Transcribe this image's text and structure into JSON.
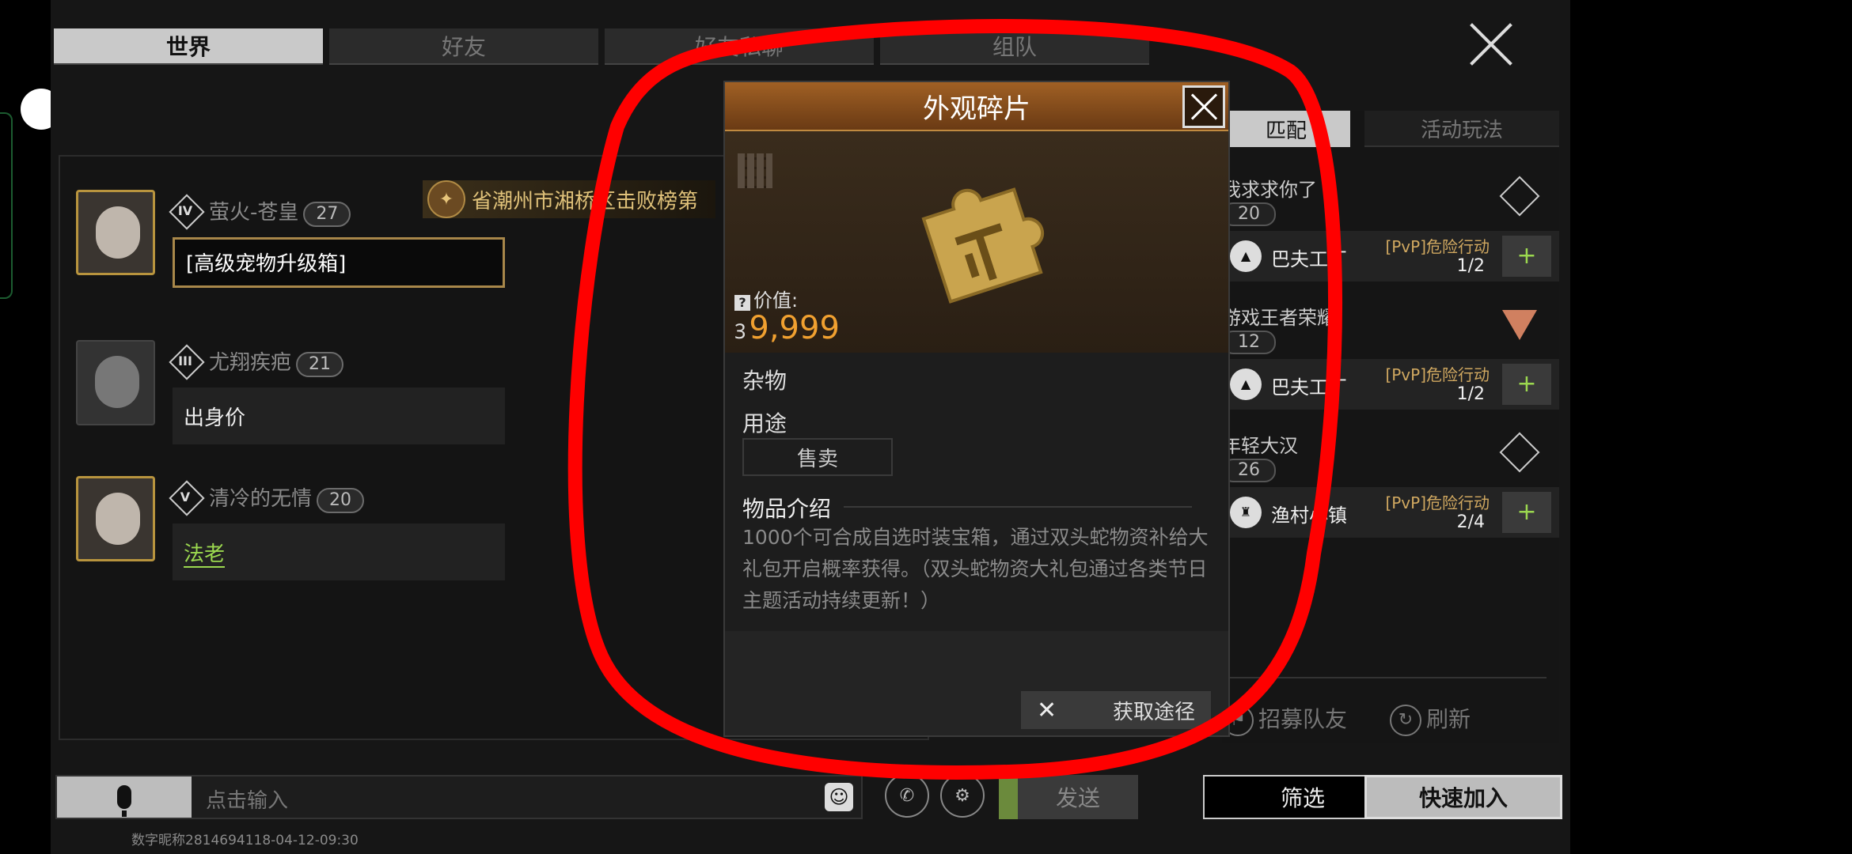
{
  "tabs": [
    "世界",
    "好友",
    "好友私聊",
    "组队"
  ],
  "chat": {
    "pinned": "省潮州市湘桥区击败榜第",
    "messages": [
      {
        "rank": "IV",
        "name": "萤火-苍皇",
        "level": "27",
        "text": "[高级宠物升级箱]"
      },
      {
        "rank": "III",
        "name": "尤翔疾疤",
        "level": "21",
        "text": "出身价"
      },
      {
        "rank": "V",
        "name": "清冷的无情",
        "level": "20",
        "text": "法老"
      }
    ]
  },
  "input": {
    "placeholder": "点击输入",
    "emoji": "☺"
  },
  "send_label": "发送",
  "footer_note": "数字昵称2814694118-04-12-09:30",
  "right_panel": {
    "tabs": [
      "匹配",
      "活动玩法"
    ],
    "teams": [
      {
        "name": "我求求你了",
        "level": "20",
        "map": "巴夫工厂",
        "mode": "[PvP]危险行动",
        "count": "1/2"
      },
      {
        "name": "游戏王者荣耀",
        "level": "12",
        "map": "巴夫工厂",
        "mode": "[PvP]危险行动",
        "count": "1/2"
      },
      {
        "name": "年轻大汉",
        "level": "26",
        "map": "渔村小镇",
        "mode": "[PvP]危险行动",
        "count": "2/4"
      }
    ],
    "recruit": "招募队友",
    "refresh": "刷新"
  },
  "buttons": {
    "filter": "筛选",
    "quick_join": "快速加入"
  },
  "modal": {
    "title": "外观碎片",
    "value_label": "价值:",
    "value": "9,999",
    "type": "杂物",
    "usage_label": "用途",
    "sell": "售卖",
    "desc_title": "物品介绍",
    "desc": "1000个可合成自选时装宝箱，通过双头蛇物资补给大礼包开启概率获得。（双头蛇物资大礼包通过各类节日主题活动持续更新！）",
    "get_path": "获取途径"
  },
  "colors": {
    "accent_gold": "#b8943e",
    "value_orange": "#f0a030",
    "annotation_red": "#ff0000",
    "plus_green": "#9bd84f"
  }
}
